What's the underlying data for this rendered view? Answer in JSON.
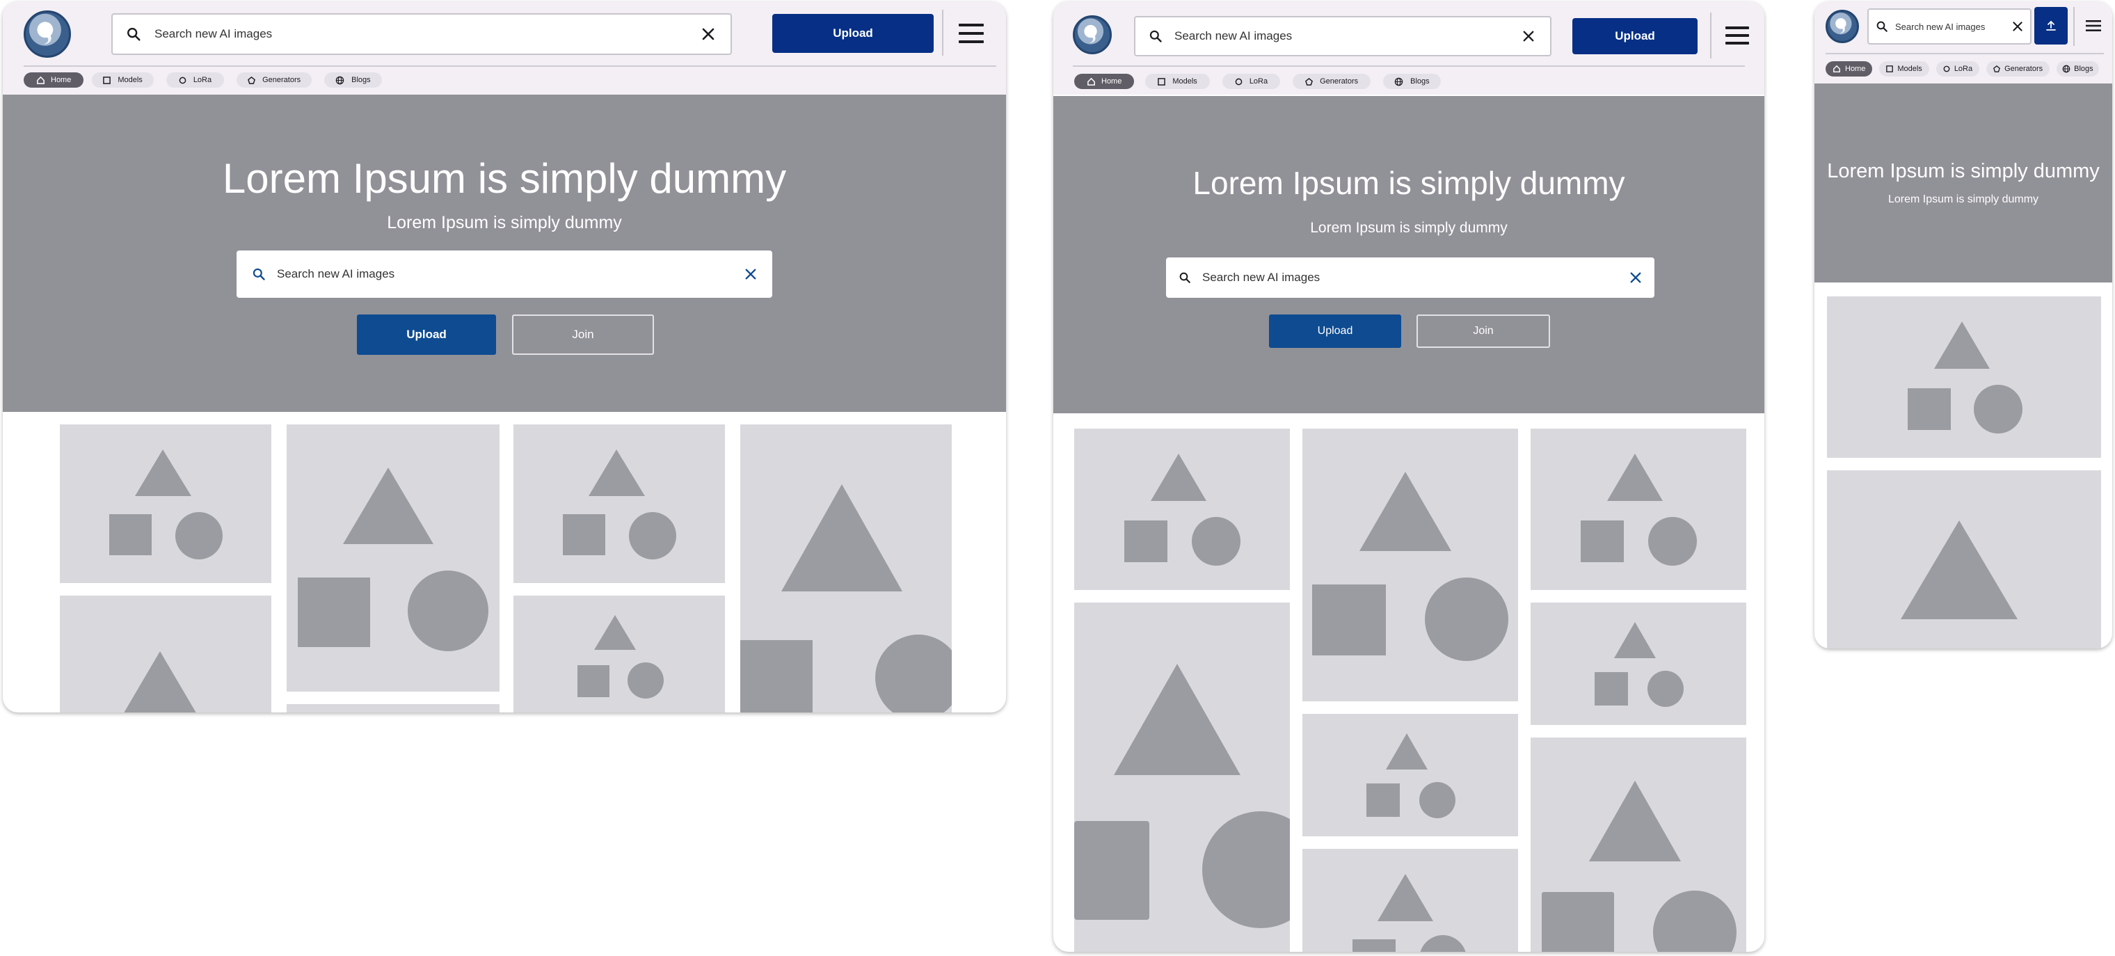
{
  "app": {
    "search_placeholder": "Search new AI images",
    "upload_label": "Upload"
  },
  "nav": {
    "chips": [
      {
        "label": "Home",
        "icon": "home-icon",
        "active": true
      },
      {
        "label": "Models",
        "icon": "square-icon",
        "active": false
      },
      {
        "label": "LoRa",
        "icon": "circle-icon",
        "active": false
      },
      {
        "label": "Generators",
        "icon": "pentagon-icon",
        "active": false
      },
      {
        "label": "Blogs",
        "icon": "globe-icon",
        "active": false
      }
    ]
  },
  "hero": {
    "title": "Lorem Ipsum is simply dummy",
    "subtitle": "Lorem Ipsum is simply dummy",
    "search_placeholder": "Search new AI images",
    "upload_label": "Upload",
    "join_label": "Join"
  },
  "colors": {
    "primary": "#062f85",
    "hero_bg": "#919198",
    "topbar_bg": "#f3eff5",
    "placeholder_bg": "#d9d9dd",
    "placeholder_shape": "#9a9ca1"
  }
}
